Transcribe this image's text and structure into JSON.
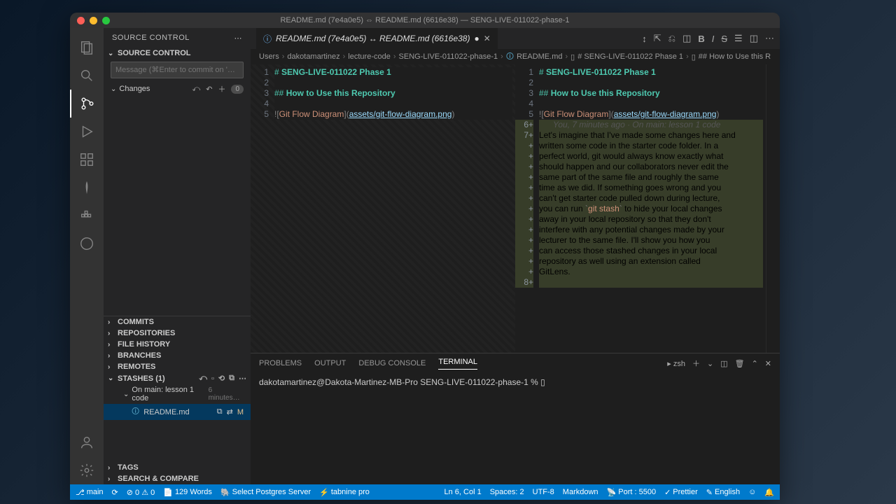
{
  "window": {
    "title": "README.md (7e4a0e5) ⇔ README.md (6616e38) — SENG-LIVE-011022-phase-1"
  },
  "tab": {
    "title": "README.md (7e4a0e5) ↔ README.md (6616e38)",
    "info_icon": "ⓘ"
  },
  "breadcrumb": [
    "Users",
    "dakotamartinez",
    "lecture-code",
    "SENG-LIVE-011022-phase-1",
    "README.md",
    "# SENG-LIVE-011022 Phase 1",
    "## How to Use this R"
  ],
  "sidebar": {
    "title": "SOURCE CONTROL",
    "more": "⋯",
    "sections": {
      "source_control": "SOURCE CONTROL",
      "commit_placeholder": "Message (⌘Enter to commit on '…",
      "changes": "Changes",
      "changes_count": "0",
      "commits": "COMMITS",
      "repositories": "REPOSITORIES",
      "file_history": "FILE HISTORY",
      "branches": "BRANCHES",
      "remotes": "REMOTES",
      "stashes": "STASHES (1)",
      "stash_item": "On main: lesson 1 code",
      "stash_time": "6 minutes…",
      "stash_file": "README.md",
      "stash_m": "M",
      "tags": "TAGS",
      "search": "SEARCH & COMPARE"
    }
  },
  "left_lines": [
    {
      "n": "1",
      "h": "# ",
      "t": "SENG-LIVE-011022 Phase 1",
      "cls": "h1"
    },
    {
      "n": "2",
      "t": ""
    },
    {
      "n": "3",
      "h": "## ",
      "t": "How to Use this Repository",
      "cls": "h2"
    },
    {
      "n": "4",
      "t": ""
    },
    {
      "n": "5",
      "t": "![Git Flow Diagram](assets/git-flow-diagram.png)",
      "md": true
    }
  ],
  "right_lines": [
    {
      "n": "1",
      "h": "# ",
      "t": "SENG-LIVE-011022 Phase 1",
      "cls": "h1"
    },
    {
      "n": "2",
      "t": ""
    },
    {
      "n": "3",
      "h": "## ",
      "t": "How to Use this Repository",
      "cls": "h2"
    },
    {
      "n": "4",
      "t": ""
    },
    {
      "n": "5",
      "t": "![Git Flow Diagram](assets/git-flow-diagram.png)",
      "md": true
    },
    {
      "n": "6+",
      "blame": "You, 7 minutes ago · On main: lesson 1 code",
      "add": true
    },
    {
      "n": "7+",
      "t": "Let's imagine that I've made some changes here and",
      "add": true
    },
    {
      "n": "+",
      "t": "written some code in the starter code folder. In a",
      "add": true
    },
    {
      "n": "+",
      "t": "perfect world, git would always know exactly what",
      "add": true
    },
    {
      "n": "+",
      "t": "should happen and our collaborators never edit the",
      "add": true
    },
    {
      "n": "+",
      "t": "same part of the same file and roughly the same",
      "add": true
    },
    {
      "n": "+",
      "t": "time as we did. If something goes wrong and you",
      "add": true
    },
    {
      "n": "+",
      "t": "can't get starter code pulled down during lecture,",
      "add": true
    },
    {
      "n": "+",
      "t": "you can run `git stash` to hide your local changes",
      "add": true,
      "code": "git stash"
    },
    {
      "n": "+",
      "t": "away in your local repository so that they don't",
      "add": true
    },
    {
      "n": "+",
      "t": "interfere with any potential changes made by your",
      "add": true
    },
    {
      "n": "+",
      "t": "lecturer to the same file. I'll show you how you",
      "add": true
    },
    {
      "n": "+",
      "t": "can access those stashed changes in your local",
      "add": true
    },
    {
      "n": "+",
      "t": "repository as well using an extension called",
      "add": true
    },
    {
      "n": "+",
      "t": "GitLens.",
      "add": true
    },
    {
      "n": "8+",
      "t": "",
      "add": true
    }
  ],
  "terminal": {
    "tabs": [
      "PROBLEMS",
      "OUTPUT",
      "DEBUG CONSOLE",
      "TERMINAL"
    ],
    "active_tab": 3,
    "shell_label": "zsh",
    "prompt": "dakotamartinez@Dakota-Martinez-MB-Pro SENG-LIVE-011022-phase-1 % ▯"
  },
  "status": {
    "branch": "main",
    "sync": "⟳",
    "errors": "⊘ 0 ⚠ 0",
    "words": "129 Words",
    "postgres": "Select Postgres Server",
    "tabnine": "tabnine pro",
    "cursor": "Ln 6, Col 1",
    "spaces": "Spaces: 2",
    "encoding": "UTF-8",
    "lang": "Markdown",
    "port": "Port : 5500",
    "prettier": "Prettier",
    "english": "English",
    "bell": "🔔"
  }
}
